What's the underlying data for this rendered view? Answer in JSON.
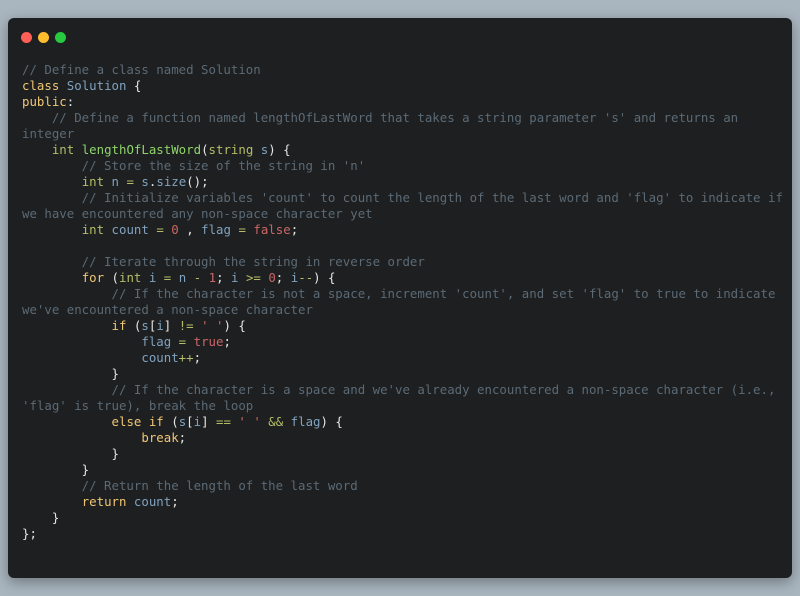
{
  "window": {
    "controls": [
      {
        "name": "close",
        "color": "#ff5f56"
      },
      {
        "name": "minimize",
        "color": "#ffbd2e"
      },
      {
        "name": "maximize",
        "color": "#27c93f"
      }
    ]
  },
  "code_lines": [
    [
      [
        "cm",
        "// Define a class named Solution"
      ]
    ],
    [
      [
        "kw",
        "class"
      ],
      [
        "pl",
        " "
      ],
      [
        "nm",
        "Solution"
      ],
      [
        "pl",
        " {"
      ]
    ],
    [
      [
        "kw",
        "public"
      ],
      [
        "pl",
        ":"
      ]
    ],
    [
      [
        "cm",
        "    // Define a function named lengthOfLastWord that takes a string parameter 's' and returns an"
      ]
    ],
    [
      [
        "cm",
        "integer"
      ]
    ],
    [
      [
        "pl",
        "    "
      ],
      [
        "ty",
        "int"
      ],
      [
        "pl",
        " "
      ],
      [
        "fn",
        "lengthOfLastWord"
      ],
      [
        "pl",
        "("
      ],
      [
        "ty",
        "string"
      ],
      [
        "pl",
        " "
      ],
      [
        "vr",
        "s"
      ],
      [
        "pl",
        ") {"
      ]
    ],
    [
      [
        "cm",
        "        // Store the size of the string in 'n'"
      ]
    ],
    [
      [
        "pl",
        "        "
      ],
      [
        "ty",
        "int"
      ],
      [
        "pl",
        " "
      ],
      [
        "vr",
        "n"
      ],
      [
        "pl",
        " "
      ],
      [
        "op",
        "="
      ],
      [
        "pl",
        " "
      ],
      [
        "vr",
        "s"
      ],
      [
        "pl",
        "."
      ],
      [
        "vr",
        "size"
      ],
      [
        "pl",
        "();"
      ]
    ],
    [
      [
        "cm",
        "        // Initialize variables 'count' to count the length of the last word and 'flag' to indicate if"
      ]
    ],
    [
      [
        "cm",
        "we have encountered any non-space character yet"
      ]
    ],
    [
      [
        "pl",
        "        "
      ],
      [
        "ty",
        "int"
      ],
      [
        "pl",
        " "
      ],
      [
        "vr",
        "count"
      ],
      [
        "pl",
        " "
      ],
      [
        "op",
        "="
      ],
      [
        "pl",
        " "
      ],
      [
        "num",
        "0"
      ],
      [
        "pl",
        " , "
      ],
      [
        "vr",
        "flag"
      ],
      [
        "pl",
        " "
      ],
      [
        "op",
        "="
      ],
      [
        "pl",
        " "
      ],
      [
        "bool",
        "false"
      ],
      [
        "pl",
        ";"
      ]
    ],
    [
      [
        "pl",
        ""
      ]
    ],
    [
      [
        "cm",
        "        // Iterate through the string in reverse order"
      ]
    ],
    [
      [
        "pl",
        "        "
      ],
      [
        "kw",
        "for"
      ],
      [
        "pl",
        " ("
      ],
      [
        "ty",
        "int"
      ],
      [
        "pl",
        " "
      ],
      [
        "vr",
        "i"
      ],
      [
        "pl",
        " "
      ],
      [
        "op",
        "="
      ],
      [
        "pl",
        " "
      ],
      [
        "vr",
        "n"
      ],
      [
        "pl",
        " "
      ],
      [
        "op",
        "-"
      ],
      [
        "pl",
        " "
      ],
      [
        "num",
        "1"
      ],
      [
        "pl",
        "; "
      ],
      [
        "vr",
        "i"
      ],
      [
        "pl",
        " "
      ],
      [
        "op",
        ">="
      ],
      [
        "pl",
        " "
      ],
      [
        "num",
        "0"
      ],
      [
        "pl",
        "; "
      ],
      [
        "vr",
        "i"
      ],
      [
        "op",
        "--"
      ],
      [
        "pl",
        ") {"
      ]
    ],
    [
      [
        "cm",
        "            // If the character is not a space, increment 'count', and set 'flag' to true to indicate"
      ]
    ],
    [
      [
        "cm",
        "we've encountered a non-space character"
      ]
    ],
    [
      [
        "pl",
        "            "
      ],
      [
        "kw",
        "if"
      ],
      [
        "pl",
        " ("
      ],
      [
        "vr",
        "s"
      ],
      [
        "pl",
        "["
      ],
      [
        "vr",
        "i"
      ],
      [
        "pl",
        "] "
      ],
      [
        "op",
        "!="
      ],
      [
        "pl",
        " "
      ],
      [
        "str",
        "' '"
      ],
      [
        "pl",
        ") {"
      ]
    ],
    [
      [
        "pl",
        "                "
      ],
      [
        "vr",
        "flag"
      ],
      [
        "pl",
        " "
      ],
      [
        "op",
        "="
      ],
      [
        "pl",
        " "
      ],
      [
        "bool",
        "true"
      ],
      [
        "pl",
        ";"
      ]
    ],
    [
      [
        "pl",
        "                "
      ],
      [
        "vr",
        "count"
      ],
      [
        "op",
        "++"
      ],
      [
        "pl",
        ";"
      ]
    ],
    [
      [
        "pl",
        "            }"
      ]
    ],
    [
      [
        "cm",
        "            // If the character is a space and we've already encountered a non-space character (i.e.,"
      ]
    ],
    [
      [
        "cm",
        "'flag' is true), break the loop"
      ]
    ],
    [
      [
        "pl",
        "            "
      ],
      [
        "kw",
        "else"
      ],
      [
        "pl",
        " "
      ],
      [
        "kw",
        "if"
      ],
      [
        "pl",
        " ("
      ],
      [
        "vr",
        "s"
      ],
      [
        "pl",
        "["
      ],
      [
        "vr",
        "i"
      ],
      [
        "pl",
        "] "
      ],
      [
        "op",
        "=="
      ],
      [
        "pl",
        " "
      ],
      [
        "str",
        "' '"
      ],
      [
        "pl",
        " "
      ],
      [
        "op",
        "&&"
      ],
      [
        "pl",
        " "
      ],
      [
        "vr",
        "flag"
      ],
      [
        "pl",
        ") {"
      ]
    ],
    [
      [
        "pl",
        "                "
      ],
      [
        "kw",
        "break"
      ],
      [
        "pl",
        ";"
      ]
    ],
    [
      [
        "pl",
        "            }"
      ]
    ],
    [
      [
        "pl",
        "        }"
      ]
    ],
    [
      [
        "cm",
        "        // Return the length of the last word"
      ]
    ],
    [
      [
        "pl",
        "        "
      ],
      [
        "kw",
        "return"
      ],
      [
        "pl",
        " "
      ],
      [
        "vr",
        "count"
      ],
      [
        "pl",
        ";"
      ]
    ],
    [
      [
        "pl",
        "    }"
      ]
    ],
    [
      [
        "pl",
        "};"
      ]
    ]
  ]
}
